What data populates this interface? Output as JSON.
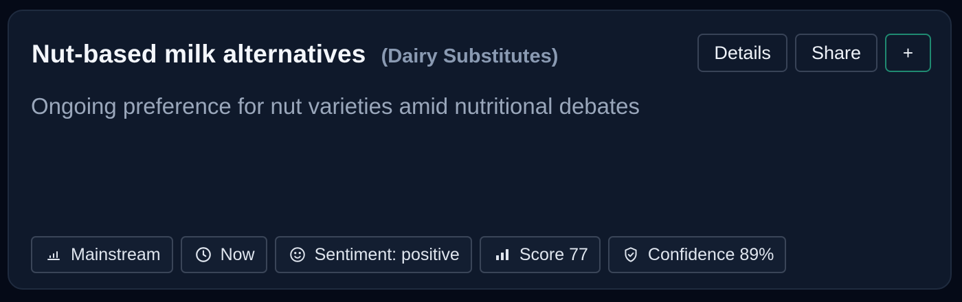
{
  "card": {
    "title": "Nut-based milk alternatives",
    "category": "(Dairy Substitutes)",
    "description": "Ongoing preference for nut varieties amid nutritional debates"
  },
  "actions": {
    "details_label": "Details",
    "share_label": "Share",
    "add_label": "+"
  },
  "chips": [
    {
      "icon": "bar-chart-low-icon",
      "label": "Mainstream"
    },
    {
      "icon": "clock-icon",
      "label": "Now"
    },
    {
      "icon": "smiley-icon",
      "label": "Sentiment: positive"
    },
    {
      "icon": "bar-chart-icon",
      "label": "Score 77"
    },
    {
      "icon": "shield-check-icon",
      "label": "Confidence 89%"
    }
  ],
  "colors": {
    "page_background": "#050a17",
    "card_background": "#0f192b",
    "accent_border": "#1f8a71"
  }
}
